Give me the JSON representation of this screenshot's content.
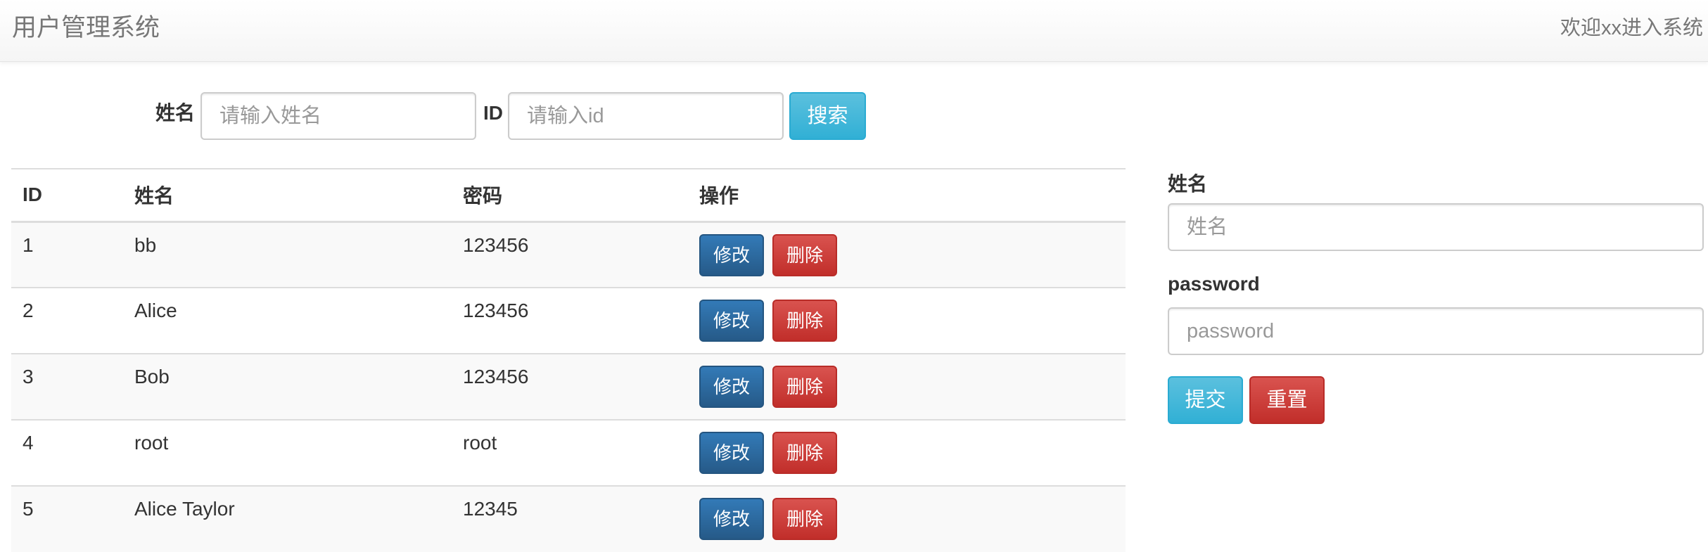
{
  "header": {
    "title": "用户管理系统",
    "welcome": "欢迎xx进入系统"
  },
  "search": {
    "name_label": "姓名",
    "name_placeholder": "请输入姓名",
    "id_label": "ID",
    "id_placeholder": "请输入id",
    "search_button": "搜索"
  },
  "table": {
    "columns": [
      "ID",
      "姓名",
      "密码",
      "操作"
    ],
    "rows": [
      {
        "id": "1",
        "name": "bb",
        "password": "123456"
      },
      {
        "id": "2",
        "name": "Alice",
        "password": "123456"
      },
      {
        "id": "3",
        "name": "Bob",
        "password": "123456"
      },
      {
        "id": "4",
        "name": "root",
        "password": "root"
      },
      {
        "id": "5",
        "name": "Alice Taylor",
        "password": "12345"
      }
    ],
    "edit_label": "修改",
    "delete_label": "删除"
  },
  "form": {
    "name_label": "姓名",
    "name_placeholder": "姓名",
    "password_label": "password",
    "password_placeholder": "password",
    "submit_button": "提交",
    "reset_button": "重置"
  },
  "colors": {
    "info": "#5bc0de",
    "primary": "#337ab7",
    "danger": "#d9534f"
  }
}
